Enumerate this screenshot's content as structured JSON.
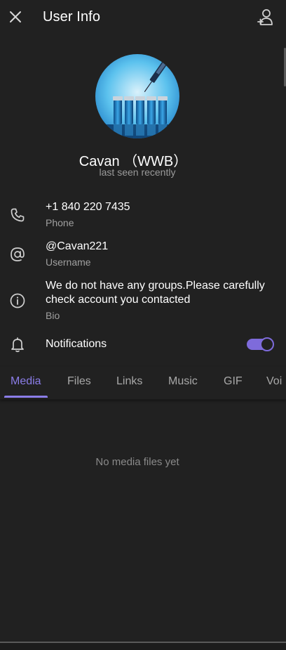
{
  "header": {
    "title": "User Info",
    "close_icon": "close-icon",
    "add_contact_icon": "add-contact-icon"
  },
  "profile": {
    "name": "Cavan （WWB）",
    "status": "last seen recently",
    "avatar": "vaccine-vials-syringe-image"
  },
  "info": {
    "phone": {
      "value": "+1 840 220 7435",
      "label": "Phone",
      "icon": "phone-icon"
    },
    "username": {
      "value": "@Cavan221",
      "label": "Username",
      "icon": "at-icon"
    },
    "bio": {
      "value_line1": "We do not have any groups.Please carefully",
      "value_line2": "check account you contacted",
      "label": "Bio",
      "icon": "info-icon"
    },
    "notifications": {
      "label": "Notifications",
      "enabled": true,
      "icon": "bell-icon"
    }
  },
  "tabs": [
    {
      "label": "Media",
      "active": true
    },
    {
      "label": "Files",
      "active": false
    },
    {
      "label": "Links",
      "active": false
    },
    {
      "label": "Music",
      "active": false
    },
    {
      "label": "GIF",
      "active": false
    },
    {
      "label": "Voi",
      "active": false
    }
  ],
  "empty_state": "No media files yet",
  "colors": {
    "background": "#212121",
    "accent": "#8b7de8",
    "toggle": "#7e6bdb",
    "secondary_text": "#a0a0a0"
  }
}
